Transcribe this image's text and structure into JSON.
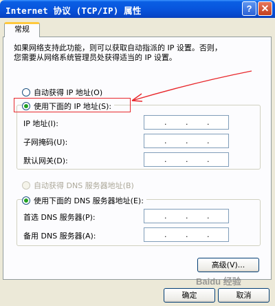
{
  "window": {
    "title": "Internet 协议 (TCP/IP) 属性",
    "help_label": "?",
    "close_label": "✕"
  },
  "tabs": [
    {
      "label": "常规",
      "active": true
    }
  ],
  "description": {
    "line1": "如果网络支持此功能，则可以获取自动指派的 IP 设置。否则，",
    "line2": "您需要从网络系统管理员处获得适当的 IP 设置。"
  },
  "ip": {
    "auto_label": "自动获得 IP 地址(O)",
    "manual_label": "使用下面的 IP 地址(S):",
    "selected": "manual",
    "fields": [
      {
        "label": "IP 地址(I):",
        "value": ". . ."
      },
      {
        "label": "子网掩码(U):",
        "value": ". . ."
      },
      {
        "label": "默认网关(D):",
        "value": ". . ."
      }
    ]
  },
  "dns": {
    "auto_label": "自动获得 DNS 服务器地址(B)",
    "auto_disabled": true,
    "manual_label": "使用下面的 DNS 服务器地址(E):",
    "selected": "manual",
    "fields": [
      {
        "label": "首选 DNS 服务器(P):",
        "value": ". . ."
      },
      {
        "label": "备用 DNS 服务器(A):",
        "value": ". . ."
      }
    ]
  },
  "buttons": {
    "advanced": "高级(V)...",
    "ok": "确定",
    "cancel": "取消"
  },
  "watermark": "Baidu 经验",
  "colors": {
    "titlebar": "#0855DD",
    "highlight": "#E8262A",
    "radio_checked": "#21A121",
    "tab_accent": "#FFC83C"
  }
}
